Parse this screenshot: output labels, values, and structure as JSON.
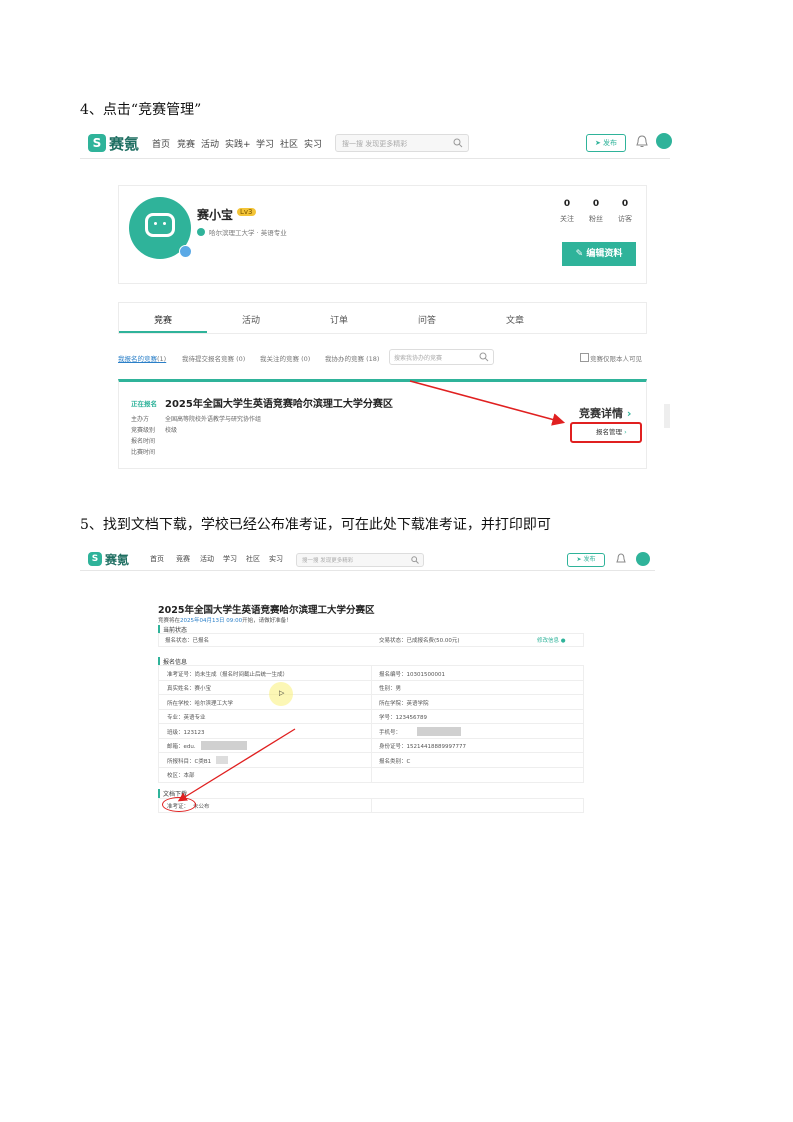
{
  "step4": {
    "heading": "4、点击“竞赛管理”"
  },
  "step5": {
    "heading": "5、找到文档下载，学校已经公布准考证，可在此处下载准考证，并打印即可"
  },
  "shot1": {
    "logo_badge": "S",
    "logo_text": "赛氪",
    "nav": [
      "首页",
      "竞赛",
      "活动",
      "实践+",
      "学习",
      "社区",
      "实习"
    ],
    "search_placeholder": "搜一搜 发现更多精彩",
    "publish_label": "发布",
    "username": "赛小宝",
    "level": "Lv3",
    "school": "哈尔滨理工大学 · 英语专业",
    "stats": [
      {
        "value": "0",
        "label": "关注"
      },
      {
        "value": "0",
        "label": "粉丝"
      },
      {
        "value": "0",
        "label": "访客"
      }
    ],
    "edit_label": "编辑资料",
    "tabs": [
      "竞赛",
      "活动",
      "订单",
      "问答",
      "文章"
    ],
    "subtabs": [
      {
        "label": "我报名的竞赛",
        "count": "(1)"
      },
      {
        "label": "我待提交报名竞赛",
        "count": "(0)"
      },
      {
        "label": "我关注的竞赛",
        "count": "(0)"
      },
      {
        "label": "我协办的竞赛",
        "count": "(18)"
      }
    ],
    "subsearch_placeholder": "搜索我协办的竞赛",
    "visibility_label": "竞赛仅限本人可见",
    "status_tag": "正在报名",
    "competition_title": "2025年全国大学生英语竞赛哈尔滨理工大学分赛区",
    "info": [
      {
        "key": "主办方",
        "value": "全国高等院校外语教学与研究协作组"
      },
      {
        "key": "竞赛级别",
        "value": "校级"
      },
      {
        "key": "报名时间",
        "value": ""
      },
      {
        "key": "比赛时间",
        "value": ""
      }
    ],
    "detail_label": "竞赛详情",
    "manage_label": "报名管理"
  },
  "shot2": {
    "logo_badge": "S",
    "logo_text": "赛氪",
    "nav": [
      "首页",
      "竞赛",
      "活动",
      "学习",
      "社区",
      "实习"
    ],
    "search_placeholder": "搜一搜 发现更多精彩",
    "publish_label": "发布",
    "title": "2025年全国大学生英语竞赛哈尔滨理工大学分赛区",
    "date_prefix": "竞赛将在",
    "date": "2025年04月13日 09:00",
    "date_suffix": "开始，请做好准备！",
    "section_status": "当前状态",
    "status_left": "报名状态：已报名",
    "status_mid": "交易状态：已成报名费(50.00元)",
    "status_right": "修改信息",
    "section_info": "报名信息",
    "fields": [
      [
        "准考证号：尚未生成（报名时间截止后统一生成）",
        "报名编号：10301500001"
      ],
      [
        "真实姓名：赛小宝",
        "性别：男"
      ],
      [
        "所在学校：哈尔滨理工大学",
        "所在学院：英语学院"
      ],
      [
        "专业：英语专业",
        "学号：123456789"
      ],
      [
        "班级：123123",
        "手机号："
      ],
      [
        "邮箱：edu.",
        "身份证号：15214418889997777"
      ],
      [
        "所报科目：C类B1",
        "报名类别：C"
      ],
      [
        "校区：本部",
        ""
      ]
    ],
    "section_docs": "文档下载",
    "doc_key": "准考证：",
    "doc_value": "未公布"
  }
}
